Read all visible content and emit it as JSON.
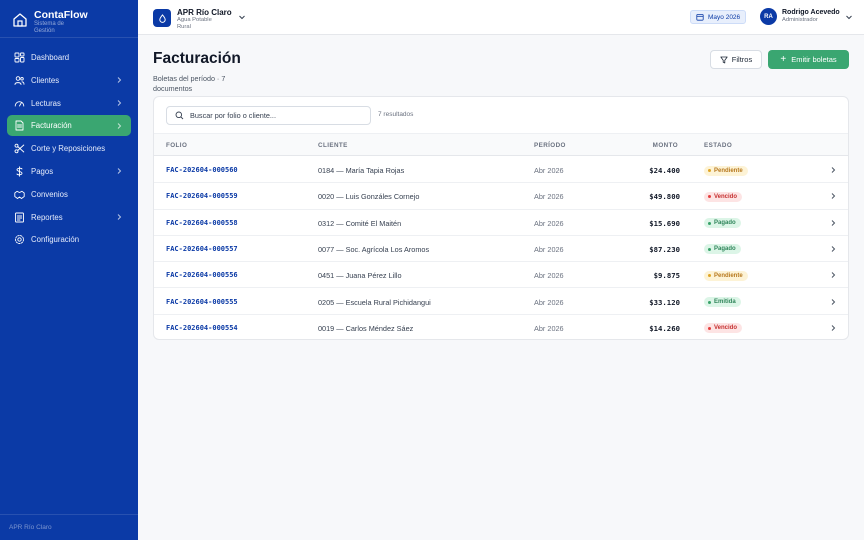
{
  "brand": {
    "name": "ContaFlow",
    "subtitle": "Sistema de Gestión"
  },
  "sidebar": {
    "items": [
      {
        "label": "Dashboard",
        "icon": "dashboard-icon",
        "chevron": false,
        "active": false
      },
      {
        "label": "Clientes",
        "icon": "users-icon",
        "chevron": true,
        "active": false
      },
      {
        "label": "Lecturas",
        "icon": "gauge-icon",
        "chevron": true,
        "active": false
      },
      {
        "label": "Facturación",
        "icon": "invoice-icon",
        "chevron": true,
        "active": true
      },
      {
        "label": "Corte y Reposiciones",
        "icon": "scissors-icon",
        "chevron": false,
        "active": false
      },
      {
        "label": "Pagos",
        "icon": "dollar-icon",
        "chevron": true,
        "active": false
      },
      {
        "label": "Convenios",
        "icon": "handshake-icon",
        "chevron": false,
        "active": false
      },
      {
        "label": "Reportes",
        "icon": "report-icon",
        "chevron": true,
        "active": false
      },
      {
        "label": "Configuración",
        "icon": "gear-icon",
        "chevron": false,
        "active": false
      }
    ],
    "footer": "APR Río Claro"
  },
  "topbar": {
    "org_name": "APR Río Claro",
    "org_subtitle": "Agua Potable Rural",
    "period": "Mayo 2026",
    "user_initials": "RA",
    "user_name": "Rodrigo Acevedo",
    "user_role": "Administrador"
  },
  "page": {
    "title": "Facturación",
    "subtitle": "Boletas del período · 7 documentos",
    "filter_label": "Filtros",
    "emit_label": "Emitir boletas"
  },
  "search": {
    "placeholder": "Buscar por folio o cliente...",
    "result_count": "7 resultados"
  },
  "table": {
    "headers": {
      "folio": "FOLIO",
      "client": "CLIENTE",
      "period": "PERÍODO",
      "amount": "MONTO",
      "status": "ESTADO"
    },
    "rows": [
      {
        "folio": "FAC-202604-000560",
        "client": "0184 — María Tapia Rojas",
        "period": "Abr 2026",
        "amount": "$24.400",
        "status": "Pendiente"
      },
      {
        "folio": "FAC-202604-000559",
        "client": "0020 — Luis Gonzáles Cornejo",
        "period": "Abr 2026",
        "amount": "$49.800",
        "status": "Vencido"
      },
      {
        "folio": "FAC-202604-000558",
        "client": "0312 — Comité El Maitén",
        "period": "Abr 2026",
        "amount": "$15.690",
        "status": "Pagado"
      },
      {
        "folio": "FAC-202604-000557",
        "client": "0077 — Soc. Agrícola Los Aromos",
        "period": "Abr 2026",
        "amount": "$87.230",
        "status": "Pagado"
      },
      {
        "folio": "FAC-202604-000556",
        "client": "0451 — Juana Pérez Lillo",
        "period": "Abr 2026",
        "amount": "$9.875",
        "status": "Pendiente"
      },
      {
        "folio": "FAC-202604-000555",
        "client": "0205 — Escuela Rural Pichidangui",
        "period": "Abr 2026",
        "amount": "$33.120",
        "status": "Emitida"
      },
      {
        "folio": "FAC-202604-000554",
        "client": "0019 — Carlos Méndez Sáez",
        "period": "Abr 2026",
        "amount": "$14.260",
        "status": "Vencido"
      }
    ]
  },
  "status_colors": {
    "Pendiente": {
      "bg": "#fdf3d6",
      "fg": "#b7791f",
      "dot": "#e0a526"
    },
    "Vencido": {
      "bg": "#fde4e4",
      "fg": "#c53030",
      "dot": "#e53e3e"
    },
    "Pagado": {
      "bg": "#dcf5e7",
      "fg": "#2f855a",
      "dot": "#38a169"
    },
    "Emitida": {
      "bg": "#dcf5e7",
      "fg": "#2f855a",
      "dot": "#38a169"
    }
  },
  "colors": {
    "primary": "#0b3aa6",
    "accent": "#3aa671"
  }
}
